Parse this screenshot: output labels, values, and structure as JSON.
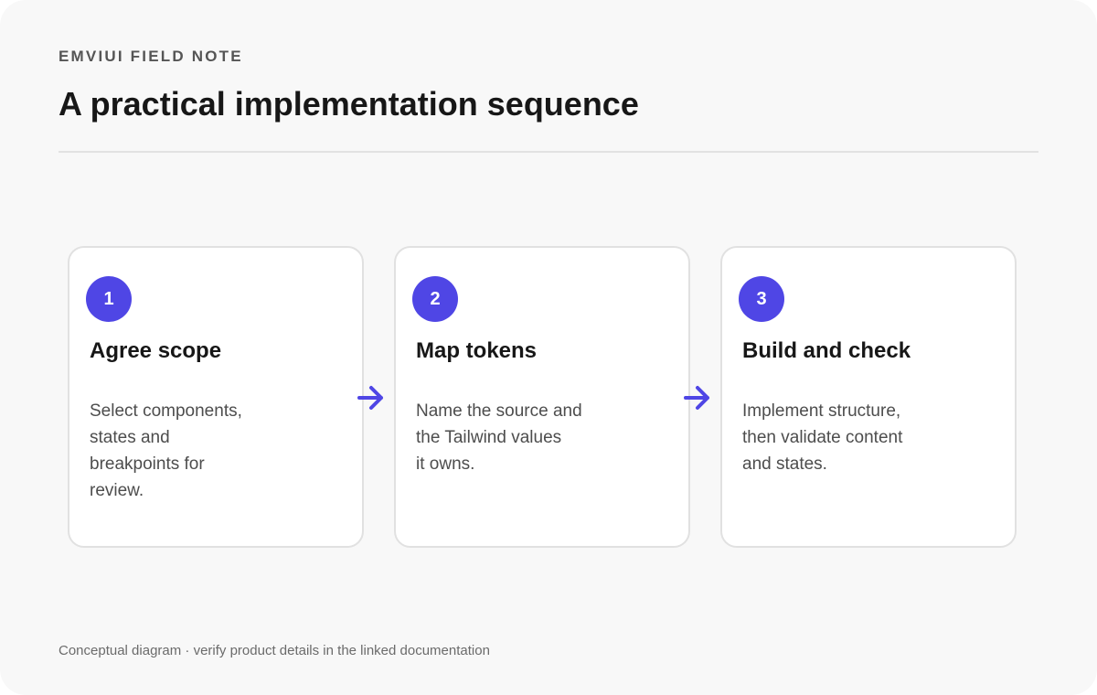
{
  "header": {
    "eyebrow": "EMVIUI FIELD NOTE",
    "title": "A practical implementation sequence"
  },
  "steps": [
    {
      "number": "1",
      "title": "Agree scope",
      "lines": [
        "Select components,",
        "states and",
        "breakpoints for",
        "review."
      ]
    },
    {
      "number": "2",
      "title": "Map tokens",
      "lines": [
        "Name the source and",
        "the Tailwind values",
        "it owns."
      ]
    },
    {
      "number": "3",
      "title": "Build and check",
      "lines": [
        "Implement structure,",
        "then validate content",
        "and states."
      ]
    }
  ],
  "connectors": [
    "arrow-right-icon",
    "arrow-right-icon"
  ],
  "footnote": "Conceptual diagram · verify product details in the linked documentation",
  "colors": {
    "accent": "#4f46e5",
    "background": "#f8f8f8",
    "card": "#ffffff",
    "card_border": "#e1e1e1",
    "title_text": "#171717",
    "body_text": "#4d4d4d",
    "muted_text": "#6b6b6b"
  }
}
